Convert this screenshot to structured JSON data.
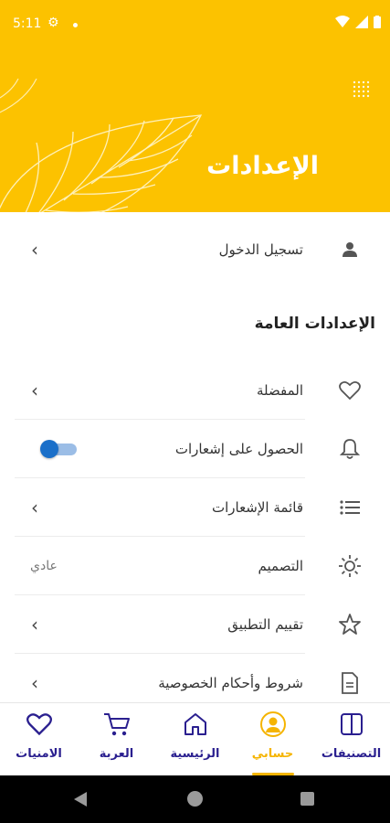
{
  "status_bar": {
    "time": "5:11"
  },
  "header": {
    "title": "الإعدادات"
  },
  "login": {
    "label": "تسجيل الدخول"
  },
  "general_settings": {
    "title": "الإعدادات العامة",
    "favorites_label": "المفضلة",
    "notifications_label": "الحصول على إشعارات",
    "notifications_enabled": true,
    "notifications_list_label": "قائمة الإشعارات",
    "theme_label": "التصميم",
    "theme_value": "عادي",
    "rate_app_label": "تقييم التطبيق",
    "terms_label": "شروط وأحكام الخصوصية"
  },
  "bottom_nav": {
    "active": "account",
    "categories_label": "التصنيفات",
    "account_label": "حسابي",
    "home_label": "الرئيسية",
    "cart_label": "العربة",
    "wishlist_label": "الامنيات"
  },
  "colors": {
    "accent": "#fcc200",
    "active_tab": "#f5b400",
    "nav_text": "#2a1f8f",
    "toggle_on": "#1a6fc9"
  }
}
